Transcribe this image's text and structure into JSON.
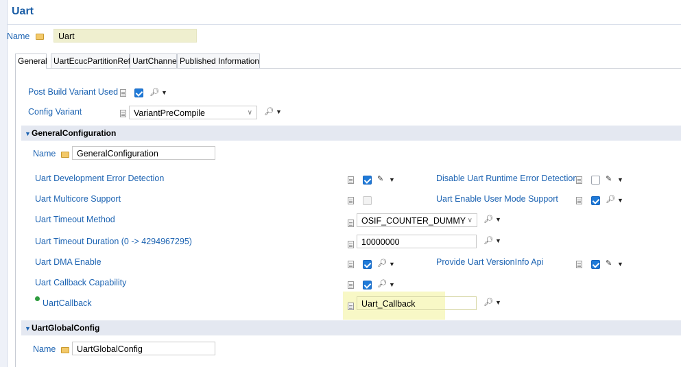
{
  "header": {
    "title": "Uart"
  },
  "name_row": {
    "label": "Name",
    "value": "Uart"
  },
  "tabs": [
    {
      "label": "General",
      "active": true
    },
    {
      "label": "UartEcucPartitionRef",
      "active": false
    },
    {
      "label": "UartChannel",
      "active": false
    },
    {
      "label": "Published Information",
      "active": false
    }
  ],
  "general": {
    "post_build_variant_used": {
      "label": "Post Build Variant Used",
      "checked": true
    },
    "config_variant": {
      "label": "Config Variant",
      "value": "VariantPreCompile"
    }
  },
  "general_configuration": {
    "title": "GeneralConfiguration",
    "name_label": "Name",
    "name_value": "GeneralConfiguration",
    "dev_error_detection": {
      "label": "Uart Development Error Detection",
      "checked": true
    },
    "disable_runtime_error_detection": {
      "label": "Disable Uart Runtime Error Detection",
      "checked": false
    },
    "multicore_support": {
      "label": "Uart Multicore Support",
      "checked": false
    },
    "enable_user_mode_support": {
      "label": "Uart Enable User Mode Support",
      "checked": true
    },
    "timeout_method": {
      "label": "Uart Timeout Method",
      "value": "OSIF_COUNTER_DUMMY"
    },
    "timeout_duration": {
      "label": "Uart Timeout Duration (0 -> 4294967295)",
      "value": "10000000"
    },
    "dma_enable": {
      "label": "Uart DMA Enable",
      "checked": true
    },
    "version_info_api": {
      "label": "Provide Uart VersionInfo Api",
      "checked": true
    },
    "callback_capability": {
      "label": "Uart Callback Capability",
      "checked": true
    },
    "callback": {
      "label": "UartCallback",
      "value": "Uart_Callback"
    }
  },
  "global_config": {
    "title": "UartGlobalConfig",
    "name_label": "Name",
    "name_value": "UartGlobalConfig"
  },
  "icons": {
    "checked": "checkbox-checked",
    "unchecked": "checkbox-unchecked",
    "pencil": "pencil-icon",
    "wand": "calculator-wand-icon",
    "dropdown": "dropdown-arrow-icon"
  },
  "colors": {
    "title": "#1b5ea6",
    "label": "#1c63b2",
    "section_bg": "#e4e8f1",
    "checkbox": "#1f7ad8",
    "name_field_bg": "#efefcf",
    "callback_highlight": "#f8f8c6"
  }
}
